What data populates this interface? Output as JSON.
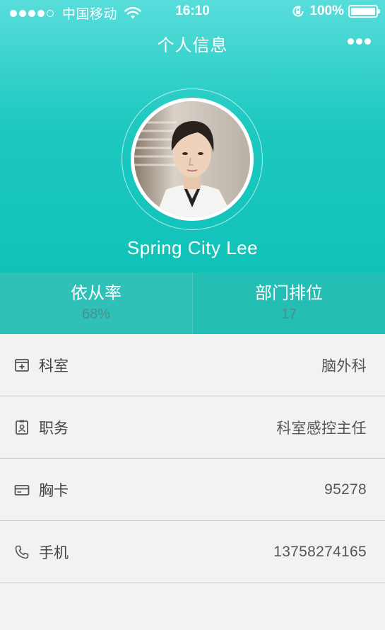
{
  "status_bar": {
    "carrier": "中国移动",
    "time": "16:10",
    "battery": "100%"
  },
  "nav": {
    "title": "个人信息"
  },
  "profile": {
    "name": "Spring City Lee"
  },
  "stats": [
    {
      "label": "依从率",
      "value": "68%"
    },
    {
      "label": "部门排位",
      "value": "17"
    }
  ],
  "info_rows": [
    {
      "icon": "department-icon",
      "label": "科室",
      "value": "脑外科"
    },
    {
      "icon": "badge-id-icon",
      "label": "职务",
      "value": "科室感控主任"
    },
    {
      "icon": "card-icon",
      "label": "胸卡",
      "value": "95278"
    },
    {
      "icon": "phone-icon",
      "label": "手机",
      "value": "13758274165"
    }
  ],
  "colors": {
    "accent": "#1ec9c0",
    "background": "#f2f2f2"
  }
}
